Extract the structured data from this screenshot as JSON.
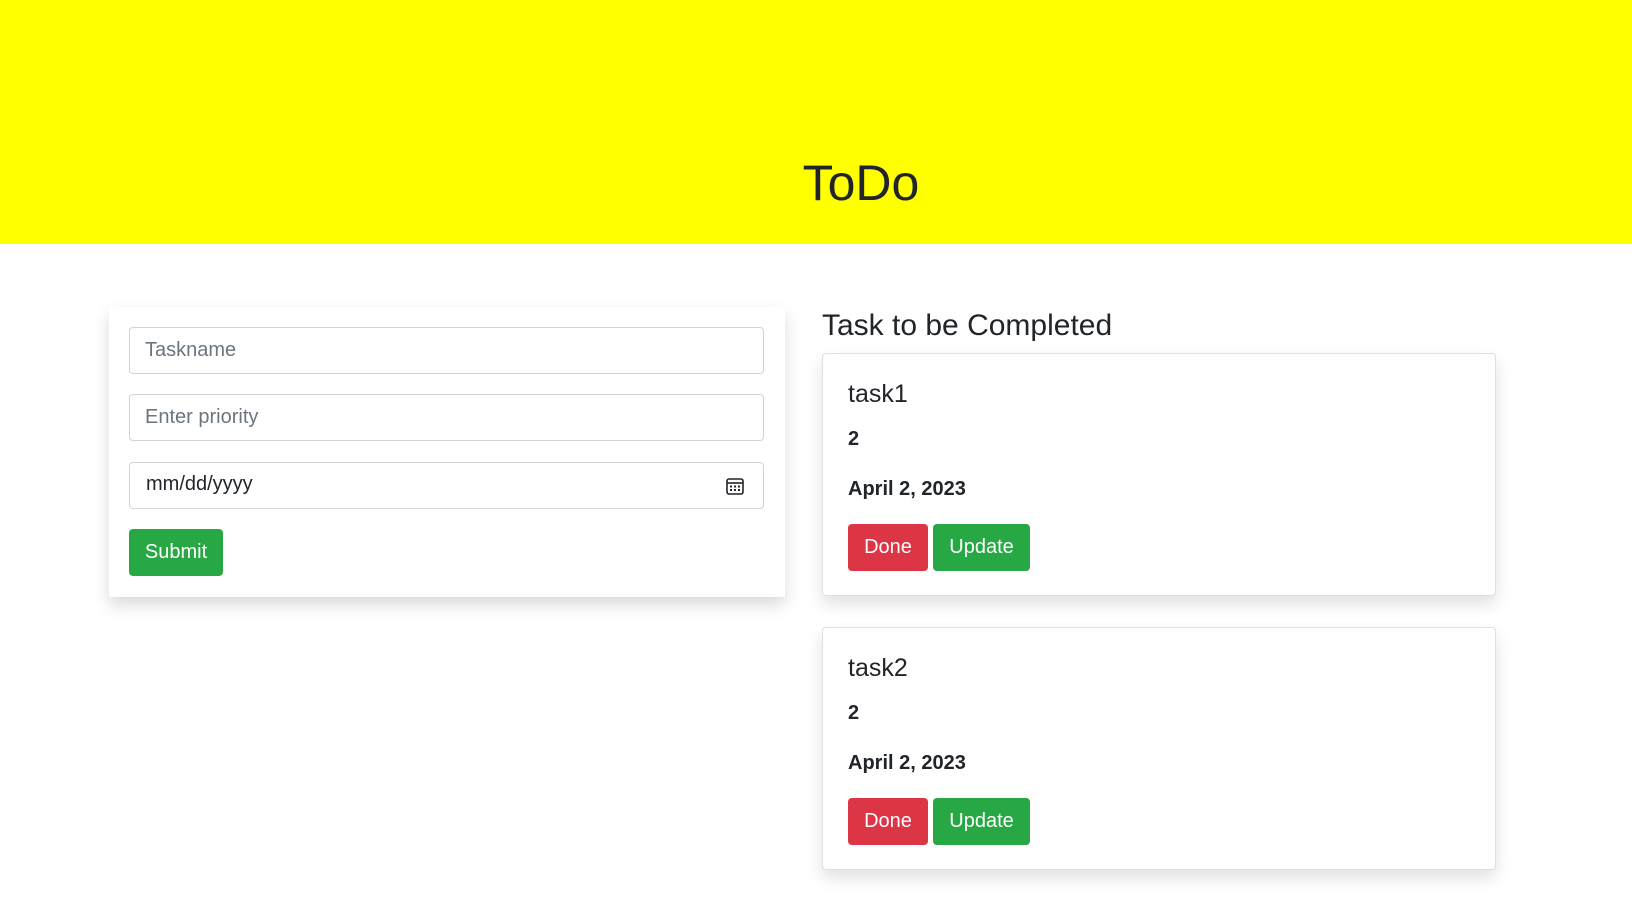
{
  "header": {
    "title": "ToDo",
    "background_color": "#ffff00"
  },
  "form": {
    "taskname_placeholder": "Taskname",
    "priority_placeholder": "Enter priority",
    "date_placeholder": "mm/dd/yyyy",
    "submit_label": "Submit"
  },
  "tasks_section": {
    "title": "Task to be Completed",
    "tasks": [
      {
        "name": "task1",
        "priority": "2",
        "date": "April 2, 2023",
        "done_label": "Done",
        "update_label": "Update"
      },
      {
        "name": "task2",
        "priority": "2",
        "date": "April 2, 2023",
        "done_label": "Done",
        "update_label": "Update"
      }
    ]
  },
  "colors": {
    "success": "#28a745",
    "danger": "#dc3545"
  }
}
